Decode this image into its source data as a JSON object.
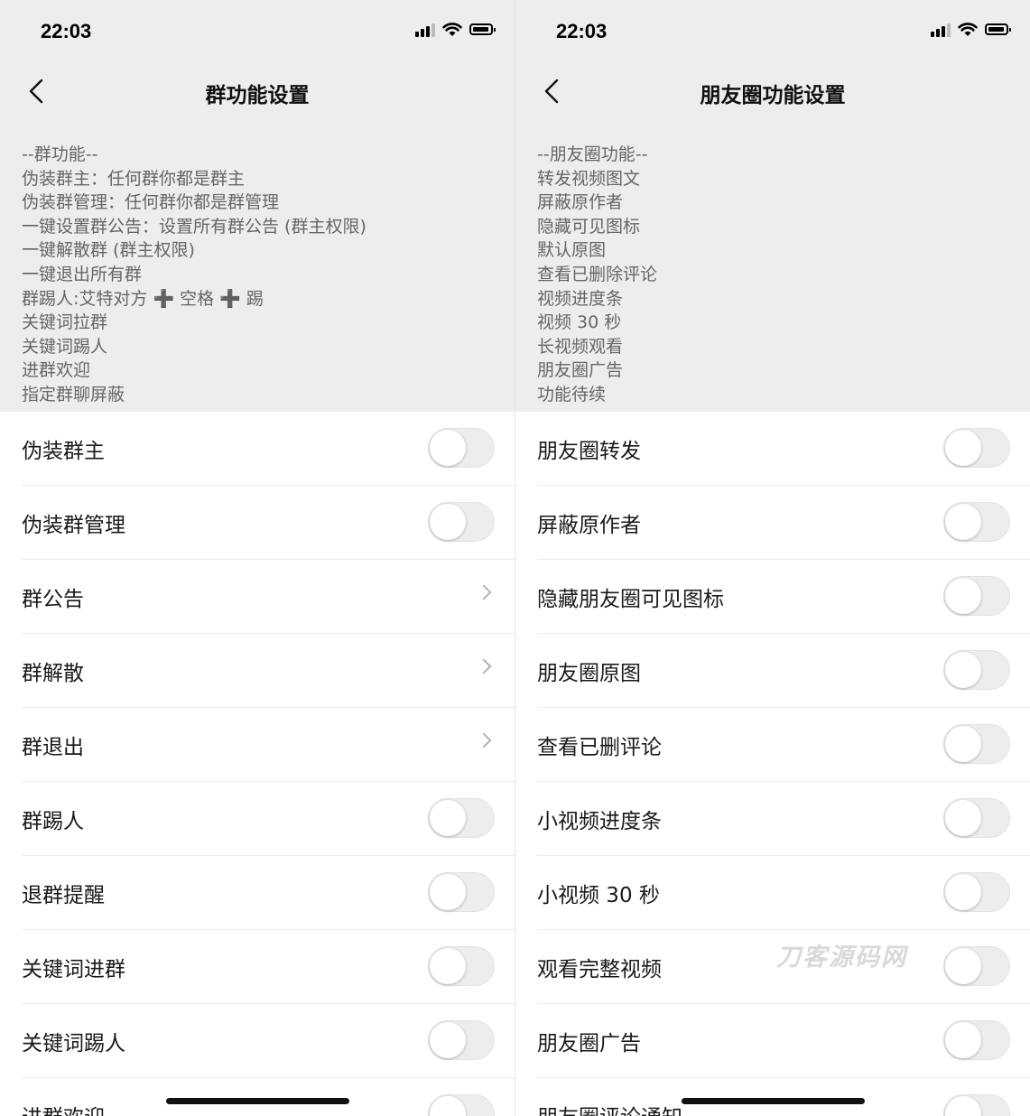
{
  "status_bar": {
    "time": "22:03"
  },
  "left": {
    "title": "群功能设置",
    "description": [
      "--群功能--",
      "伪装群主：任何群你都是群主",
      "伪装群管理：任何群你都是群管理",
      "一键设置群公告：设置所有群公告 (群主权限)",
      "一键解散群 (群主权限)",
      "一键退出所有群",
      "群踢人:艾特对方 ➕ 空格 ➕ 踢",
      "关键词拉群",
      "关键词踢人",
      "进群欢迎",
      "指定群聊屏蔽"
    ],
    "items": [
      {
        "label": "伪装群主",
        "control": "toggle",
        "on": false
      },
      {
        "label": "伪装群管理",
        "control": "toggle",
        "on": false
      },
      {
        "label": "群公告",
        "control": "chevron"
      },
      {
        "label": "群解散",
        "control": "chevron"
      },
      {
        "label": "群退出",
        "control": "chevron"
      },
      {
        "label": "群踢人",
        "control": "toggle",
        "on": false
      },
      {
        "label": "退群提醒",
        "control": "toggle",
        "on": false
      },
      {
        "label": "关键词进群",
        "control": "toggle",
        "on": false
      },
      {
        "label": "关键词踢人",
        "control": "toggle",
        "on": false
      },
      {
        "label": "进群欢迎",
        "control": "toggle",
        "on": false
      }
    ]
  },
  "right": {
    "title": "朋友圈功能设置",
    "description": [
      "--朋友圈功能--",
      "转发视频图文",
      "屏蔽原作者",
      "隐藏可见图标",
      "默认原图",
      "查看已删除评论",
      "视频进度条",
      "视频 30 秒",
      "长视频观看",
      "朋友圈广告",
      "功能待续"
    ],
    "items": [
      {
        "label": "朋友圈转发",
        "control": "toggle",
        "on": false
      },
      {
        "label": "屏蔽原作者",
        "control": "toggle",
        "on": false
      },
      {
        "label": "隐藏朋友圈可见图标",
        "control": "toggle",
        "on": false
      },
      {
        "label": "朋友圈原图",
        "control": "toggle",
        "on": false
      },
      {
        "label": "查看已删评论",
        "control": "toggle",
        "on": false
      },
      {
        "label": "小视频进度条",
        "control": "toggle",
        "on": false
      },
      {
        "label": "小视频 30 秒",
        "control": "toggle",
        "on": false
      },
      {
        "label": "观看完整视频",
        "control": "toggle",
        "on": false
      },
      {
        "label": "朋友圈广告",
        "control": "toggle",
        "on": false
      },
      {
        "label": "朋友圈评论通知",
        "control": "toggle",
        "on": false
      }
    ]
  },
  "watermark": "刀客源码网",
  "colors": {
    "header_bg": "#ededed",
    "toggle_off": "#ededed",
    "text": "#1a1a1a"
  }
}
